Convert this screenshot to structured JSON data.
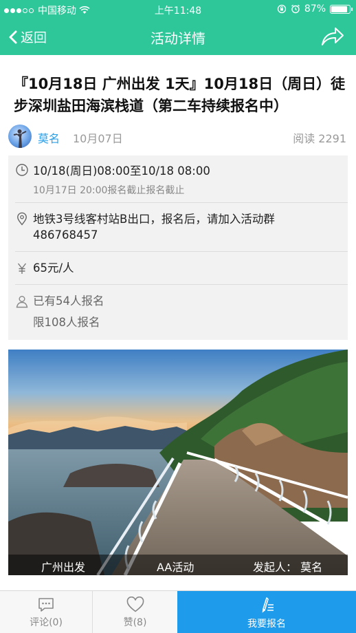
{
  "status": {
    "carrier": "中国移动",
    "time": "上午11:48",
    "battery": "87%"
  },
  "nav": {
    "back_label": "返回",
    "title": "活动详情"
  },
  "article": {
    "title": "『10月18日 广州出发 1天』10月18日（周日）徒步深圳盐田海滨栈道（第二车持续报名中）",
    "author": "莫名",
    "date": "10月07日",
    "reads": "阅读 2291"
  },
  "info": {
    "time_main": "10/18(周日)08:00至10/18 08:00",
    "time_sub": "10月17日 20:00报名截止报名截止",
    "location": "地铁3号线客村站B出口，报名后，请加入活动群486768457",
    "price": "65元/人",
    "signed_up": "已有54人报名",
    "limit": "限108人报名"
  },
  "photo": {
    "origin": "广州出发",
    "type": "AA活动",
    "organizer": "发起人：  莫名"
  },
  "tabs": {
    "comment": "评论(0)",
    "like": "赞(8)",
    "signup": "我要报名"
  },
  "colors": {
    "brand": "#2ec79a",
    "accent": "#1e9bea",
    "link": "#2aa0e8"
  }
}
